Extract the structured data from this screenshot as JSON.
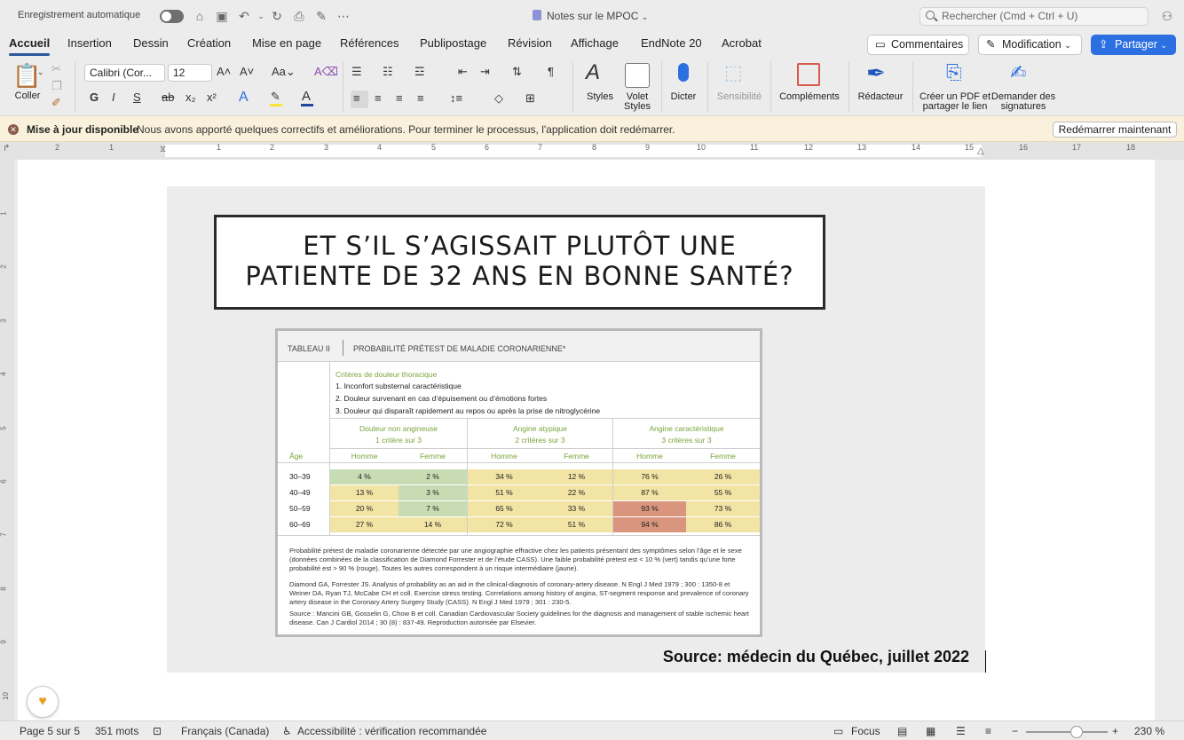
{
  "titlebar": {
    "autosave_label": "Enregistrement automatique",
    "doc_title": "Notes sur le MPOC",
    "search_placeholder": "Rechercher (Cmd + Ctrl + U)"
  },
  "tabs": [
    "Accueil",
    "Insertion",
    "Dessin",
    "Création",
    "Mise en page",
    "Références",
    "Publipostage",
    "Révision",
    "Affichage",
    "EndNote 20",
    "Acrobat"
  ],
  "actions": {
    "comments": "Commentaires",
    "editing": "Modification",
    "share": "Partager"
  },
  "ribbon": {
    "paste": "Coller",
    "font_name": "Calibri (Cor...",
    "font_size": "12",
    "styles": "Styles",
    "styles_pane": "Volet\nStyles",
    "dictate": "Dicter",
    "sensitivity": "Sensibilité",
    "addins": "Compléments",
    "editor": "Rédacteur",
    "create_pdf": "Créer un PDF et\npartager le lien",
    "request_sig": "Demander des\nsignatures",
    "bold": "G",
    "italic": "I",
    "underline": "S"
  },
  "notification": {
    "title": "Mise à jour disponible",
    "message": "Nous avons apporté quelques correctifs et améliorations. Pour terminer le processus, l'application doit  redémarrer.",
    "button": "Redémarrer maintenant"
  },
  "ruler": [
    "2",
    "1",
    "1",
    "2",
    "3",
    "4",
    "5",
    "6",
    "7",
    "8",
    "9",
    "10",
    "11",
    "12",
    "13",
    "14",
    "15",
    "16",
    "17",
    "18"
  ],
  "vruler": [
    "1",
    "2",
    "3",
    "4",
    "5",
    "6",
    "7",
    "8",
    "9",
    "10"
  ],
  "slide": {
    "headline_line1": "ET S’IL S’AGISSAIT PLUTÔT UNE",
    "headline_line2": "PATIENTE DE 32 ANS EN BONNE SANTÉ?",
    "source": "Source: médecin du Québec, juillet 2022"
  },
  "table": {
    "label": "TABLEAU II",
    "title": "PROBABILITÉ PRÉTEST DE MALADIE CORONARIENNE*",
    "criteria_title": "Critères de douleur thoracique",
    "criteria": [
      "1.   Inconfort substernal caractéristique",
      "2.   Douleur survenant en cas d’épuisement ou d’émotions fortes",
      "3.   Douleur qui disparaît rapidement au repos ou après la prise de nitroglycérine"
    ],
    "groups": [
      {
        "name": "Douleur non angineuse",
        "sub": "1 critère sur 3"
      },
      {
        "name": "Angine atypique",
        "sub": "2 critères sur 3"
      },
      {
        "name": "Angine caractéristique",
        "sub": "3 critères sur 3"
      }
    ],
    "age_header": "Âge",
    "sex_headers": [
      "Homme",
      "Femme",
      "Homme",
      "Femme",
      "Homme",
      "Femme"
    ],
    "rows": [
      {
        "age": "30–39",
        "values": [
          "4 %",
          "2 %",
          "34 %",
          "12 %",
          "76 %",
          "26 %"
        ],
        "colors": [
          "g",
          "g",
          "y",
          "y",
          "y",
          "y"
        ]
      },
      {
        "age": "40–49",
        "values": [
          "13 %",
          "3 %",
          "51 %",
          "22 %",
          "87 %",
          "55 %"
        ],
        "colors": [
          "y",
          "g",
          "y",
          "y",
          "y",
          "y"
        ]
      },
      {
        "age": "50–59",
        "values": [
          "20 %",
          "7 %",
          "65 %",
          "33 %",
          "93 %",
          "73 %"
        ],
        "colors": [
          "y",
          "g",
          "y",
          "y",
          "r",
          "y"
        ]
      },
      {
        "age": "60–69",
        "values": [
          "27 %",
          "14 %",
          "72 %",
          "51 %",
          "94 %",
          "86 %"
        ],
        "colors": [
          "y",
          "y",
          "y",
          "y",
          "r",
          "y"
        ]
      }
    ],
    "colors": {
      "g": "#c8dcb4",
      "y": "#f2e4a4",
      "r": "#d9957e"
    },
    "note1": "Probabilité prétest de maladie coronarienne détectée par une angiographie effractive chez les patients présentant des symptômes selon l’âge et le sexe (données combinées de la classification de Diamond Forrester et de l’étude CASS). Une faible probabilité prétest est < 10 % (vert) tandis qu’une forte probabilité est > 90 % (rouge). Toutes les autres correspondent à un risque intermédiaire (jaune).",
    "note2": "Diamond GA, Forrester JS. Analysis of probability as an aid in the clinical-diagnosis of coronary-artery disease. N Engl J Med 1979 ; 300 : 1350-8 et Weiner DA, Ryan TJ, McCabe CH et coll. Exercise stress testing. Correlations among history of angina, ST-segment response and prevalence of coronary artery disease in the Coronary Artery Surgery Study (CASS). N Engl J Med 1979 ; 301 : 230-5.",
    "note3": "Source : Mancini GB, Gosselin G, Chow B et coll. Canadian Cardiovascular Society guidelines for the diagnosis and management of stable ischemic heart disease. Can J Cardiol 2014 ; 30 (8) : 837-49. Reproduction autorisée par Elsevier."
  },
  "status": {
    "page": "Page 5 sur 5",
    "words": "351 mots",
    "language": "Français (Canada)",
    "accessibility": "Accessibilité : vérification recommandée",
    "focus": "Focus",
    "zoom": "230 %"
  }
}
